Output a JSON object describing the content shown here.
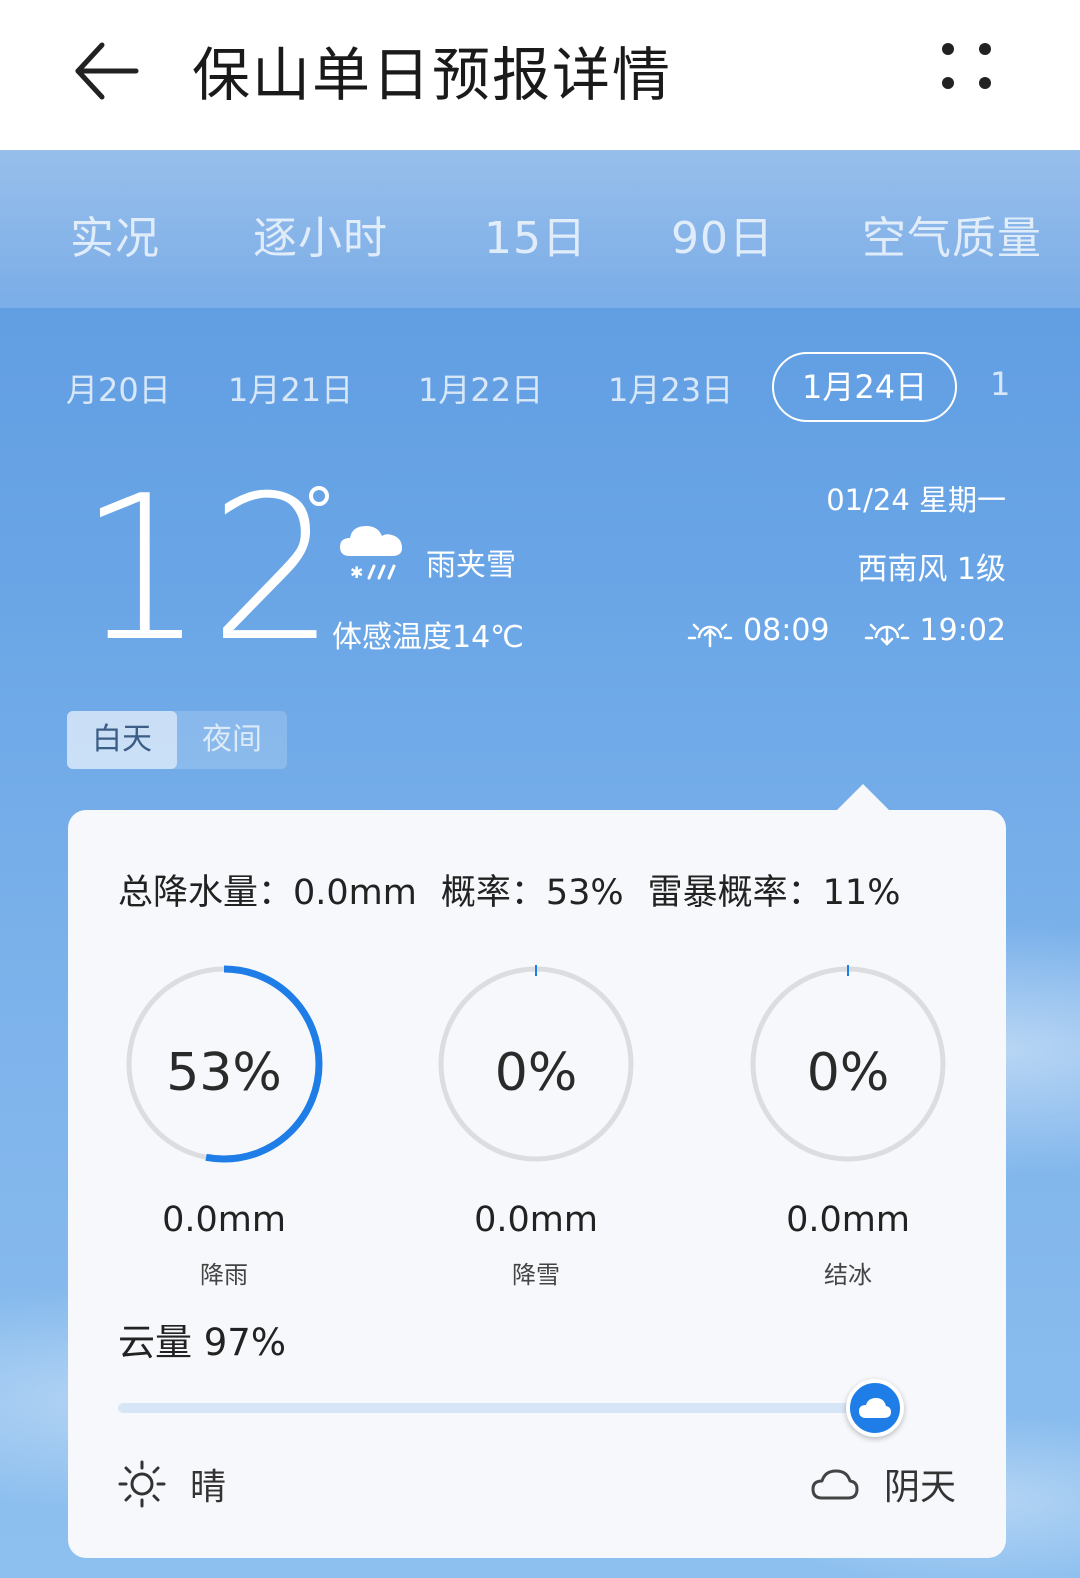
{
  "header": {
    "title": "保山单日预报详情",
    "back_icon": "arrow-left-icon",
    "more_icon": "more-dots-icon"
  },
  "main_tabs": [
    {
      "label": "实况"
    },
    {
      "label": "逐小时"
    },
    {
      "label": "15日"
    },
    {
      "label": "90日"
    },
    {
      "label": "空气质量"
    }
  ],
  "dates": [
    {
      "label": "月20日"
    },
    {
      "label": "1月21日"
    },
    {
      "label": "1月22日"
    },
    {
      "label": "1月23日"
    },
    {
      "label": "1月24日",
      "selected": true
    },
    {
      "label": "1"
    }
  ],
  "current": {
    "temperature": "12",
    "condition": "雨夹雪",
    "feels_like": "体感温度14℃",
    "date_weekday": "01/24 星期一",
    "wind": "西南风 1级",
    "sunrise": "08:09",
    "sunset": "19:02"
  },
  "day_night": {
    "day": "白天",
    "night": "夜间",
    "selected": "day"
  },
  "precipitation": {
    "total": "总降水量：0.0mm",
    "probability": "概率：53%",
    "thunder": "雷暴概率：11%",
    "items": [
      {
        "percent": 53,
        "percent_label": "53%",
        "amount": "0.0mm",
        "label": "降雨"
      },
      {
        "percent": 0,
        "percent_label": "0%",
        "amount": "0.0mm",
        "label": "降雪"
      },
      {
        "percent": 0,
        "percent_label": "0%",
        "amount": "0.0mm",
        "label": "结冰"
      }
    ]
  },
  "cloud": {
    "title": "云量 97%",
    "value_fraction": 0.97,
    "left_label": "晴",
    "right_label": "阴天"
  },
  "colors": {
    "accent": "#1e7de6",
    "ring_track": "#dcdde0",
    "sky": "#69a5e6"
  }
}
